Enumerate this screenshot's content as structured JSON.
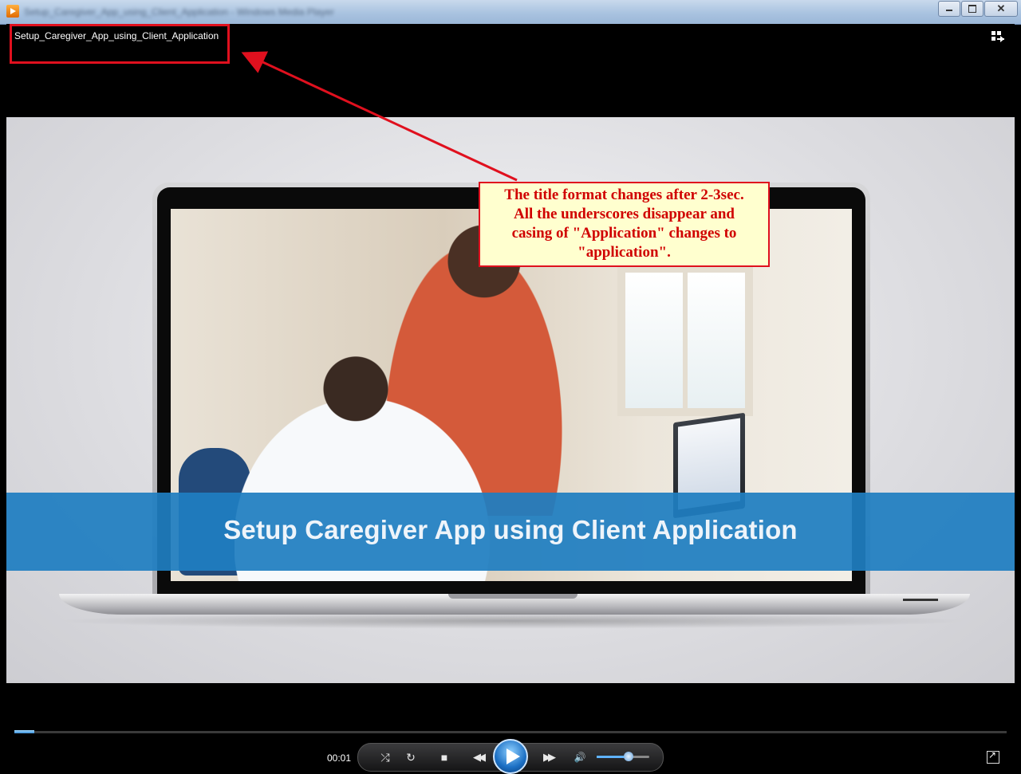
{
  "window": {
    "title": "Setup_Caregiver_App_using_Client_Application - Windows Media Player"
  },
  "player": {
    "file_title": "Setup_Caregiver_App_using_Client_Application",
    "video_banner": "Setup Caregiver App using Client Application",
    "time": "00:01",
    "progress": 0.02,
    "volume": 0.6
  },
  "annotation": {
    "lines": [
      "The title format changes after 2-3sec.",
      "All the underscores disappear and",
      "casing of \"Application\" changes to",
      "\"application\"."
    ],
    "color": "#e0101e"
  },
  "controls": {
    "shuffle": "⤮",
    "repeat": "↻",
    "stop": "■",
    "previous": "◀◀",
    "next": "▶▶",
    "mute": "🔊"
  }
}
